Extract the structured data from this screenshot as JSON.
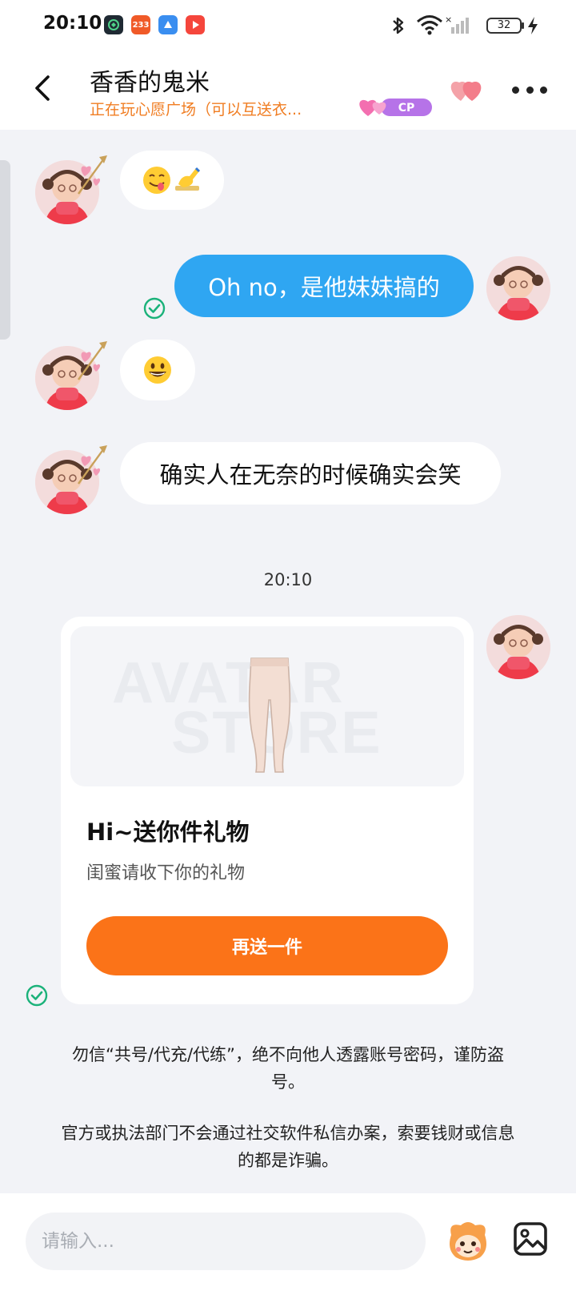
{
  "status_bar": {
    "time": "20:10",
    "app_icons": [
      {
        "icon": "green-app-icon",
        "color": "#1f2a33",
        "label": ""
      },
      {
        "icon": "app-233-icon",
        "color": "#f05a28",
        "label": "233"
      },
      {
        "icon": "blue-app-icon",
        "color": "#3a8ef0",
        "label": ""
      },
      {
        "icon": "video-app-icon",
        "color": "#f5463c",
        "label": ""
      }
    ],
    "battery": "32"
  },
  "header": {
    "name": "香香的鬼米",
    "status": "正在玩心愿广场（可以互送衣...",
    "badge": "CP"
  },
  "messages": {
    "m1": "😋✍",
    "m2": "Oh no，是他妹妹搞的",
    "m3": "😃",
    "m4": "确实人在无奈的时候确实会笑"
  },
  "timestamp": "20:10",
  "gift_card": {
    "watermark_line1": "AVATAR",
    "watermark_line2": "STORE",
    "title": "Hi~送你件礼物",
    "subtitle": "闺蜜请收下你的礼物",
    "button_label": "再送一件"
  },
  "notices": {
    "notice1": "勿信“共号/代充/代练”，绝不向他人透露账号密码，谨防盗号。",
    "notice2": "官方或执法部门不会通过社交软件私信办案，索要钱财或信息的都是诈骗。"
  },
  "input": {
    "placeholder": "请输入..."
  },
  "colors": {
    "accent_orange": "#fb7318",
    "my_bubble_blue": "#2fa6f2",
    "status_orange": "#f07d22",
    "check_green": "#1bb27a"
  }
}
